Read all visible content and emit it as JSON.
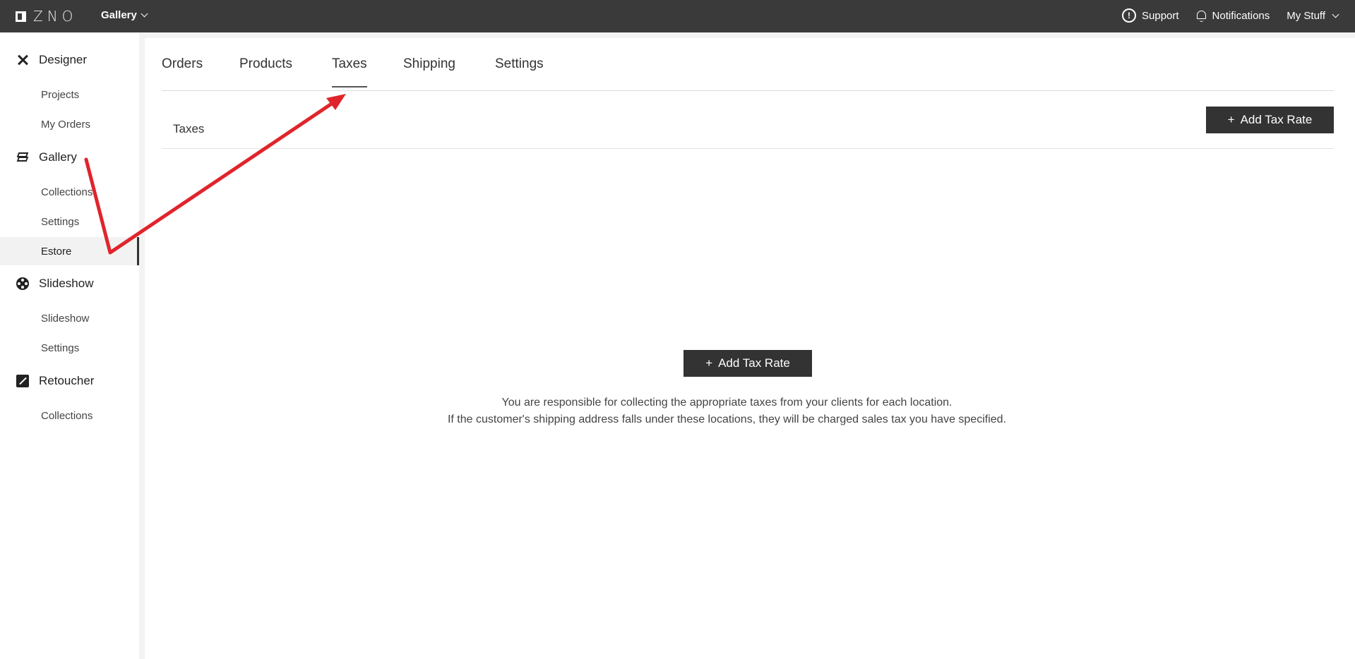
{
  "topbar": {
    "logo_text": "ZNO",
    "app_menu": "Gallery",
    "support": "Support",
    "notifications": "Notifications",
    "my_stuff": "My Stuff"
  },
  "sidebar": {
    "sections": [
      {
        "label": "Designer",
        "icon": "designer-icon",
        "items": [
          "Projects",
          "My Orders"
        ]
      },
      {
        "label": "Gallery",
        "icon": "layers-icon",
        "items": [
          "Collections",
          "Settings",
          "Estore"
        ]
      },
      {
        "label": "Slideshow",
        "icon": "film-reel-icon",
        "items": [
          "Slideshow",
          "Settings"
        ]
      },
      {
        "label": "Retoucher",
        "icon": "retouch-icon",
        "items": [
          "Collections"
        ]
      }
    ],
    "active_item": "Estore"
  },
  "tabs": [
    "Orders",
    "Products",
    "Taxes",
    "Shipping",
    "Settings"
  ],
  "active_tab": "Taxes",
  "taxes": {
    "title": "Taxes",
    "add_button": "Add Tax Rate",
    "add_button_symbol": "+",
    "empty_line1": "You are responsible for collecting the appropriate taxes from your clients for each location.",
    "empty_line2": "If the customer's shipping address falls under these locations, they will be charged sales tax you have specified."
  },
  "colors": {
    "topbar": "#3a3a3a",
    "button": "#333333",
    "annotation_arrow": "#e0242b"
  }
}
